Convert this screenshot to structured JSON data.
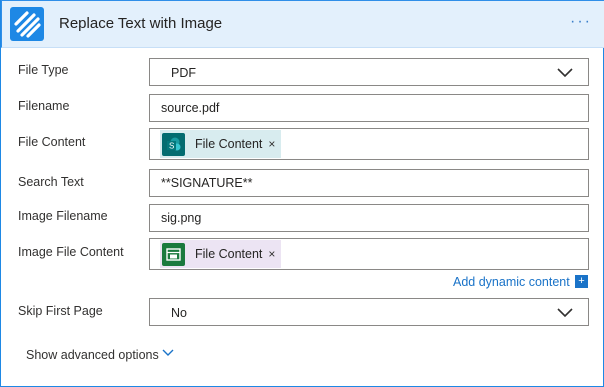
{
  "header": {
    "title": "Replace Text with Image",
    "more": "···",
    "logo_icon": "stripes-logo-icon",
    "accent": "#1e88e5"
  },
  "fields": {
    "file_type": {
      "label": "File Type",
      "value": "PDF"
    },
    "filename": {
      "label": "Filename",
      "value": "source.pdf"
    },
    "file_content": {
      "label": "File Content",
      "token": "File Content",
      "token_icon": "sharepoint-icon",
      "remove": "×"
    },
    "search_text": {
      "label": "Search Text",
      "value": "**SIGNATURE**"
    },
    "image_filename": {
      "label": "Image Filename",
      "value": "sig.png"
    },
    "image_file_content": {
      "label": "Image File Content",
      "token": "File Content",
      "token_icon": "excel-online-icon",
      "remove": "×"
    },
    "skip_first_page": {
      "label": "Skip First Page",
      "value": "No"
    }
  },
  "dynamic_content": {
    "label": "Add dynamic content",
    "plus": "+"
  },
  "advanced": {
    "label": "Show advanced options"
  }
}
